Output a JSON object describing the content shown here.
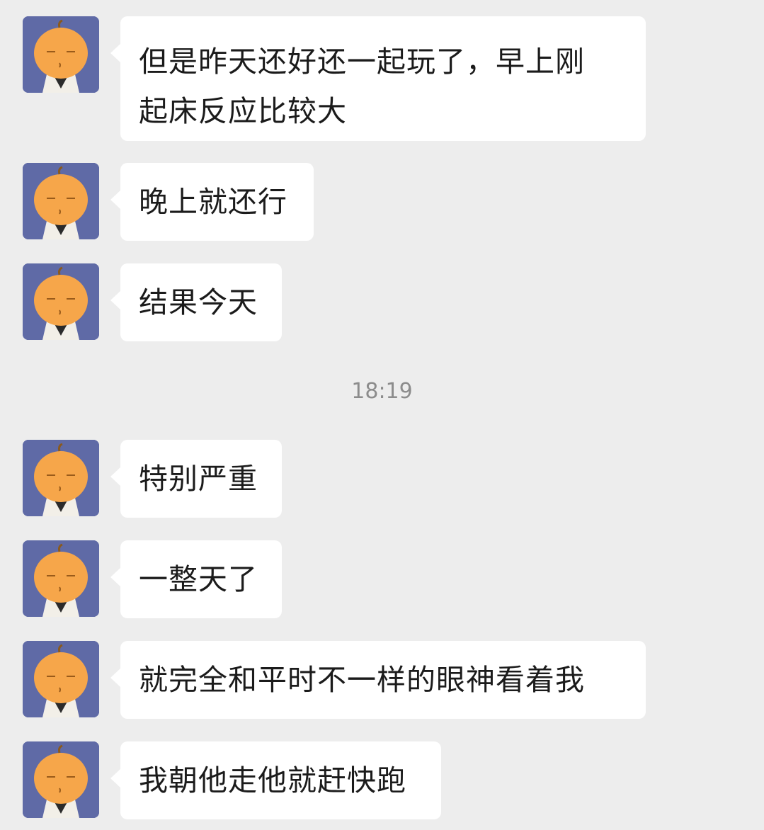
{
  "timestamp": "18:19",
  "messages": [
    {
      "text": "但是昨天还好还一起玩了，早上刚\n起床反应比较大"
    },
    {
      "text": "晚上就还行"
    },
    {
      "text": "结果今天"
    },
    {
      "text": "特别严重"
    },
    {
      "text": "一整天了"
    },
    {
      "text": "就完全和平时不一样的眼神看着我"
    },
    {
      "text": "我朝他走他就赶快跑"
    }
  ],
  "avatar": {
    "icon": "pumpkin-head-avatar-icon",
    "bg_color": "#5f6aa6",
    "head_color": "#f6a64a"
  }
}
